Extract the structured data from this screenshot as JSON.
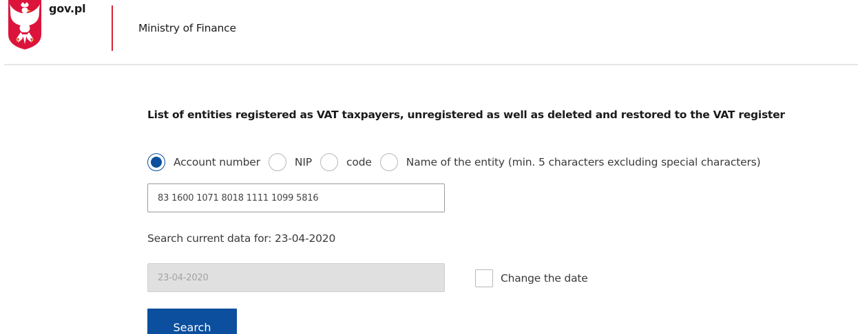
{
  "header": {
    "site_name": "gov.pl",
    "ministry": "Ministry of Finance",
    "colors": {
      "divider": "#d5232f",
      "emblem_bg": "#dc143c"
    }
  },
  "main": {
    "title": "List of entities registered as VAT taxpayers, unregistered as well as deleted and restored to the VAT register",
    "search_type": {
      "options": [
        {
          "label": "Account number",
          "checked": true
        },
        {
          "label": "NIP",
          "checked": false
        },
        {
          "label": "code",
          "checked": false
        },
        {
          "label": "Name of the entity (min. 5 characters excluding special characters)",
          "checked": false
        }
      ]
    },
    "account_input": {
      "value": "83 1600 1071 8018 1111 1099 5816"
    },
    "current_data_text": "Search current data for: 23-04-2020",
    "date_input": {
      "value": "23-04-2020",
      "disabled": true
    },
    "change_date": {
      "label": "Change the date",
      "checked": false
    },
    "search_button": {
      "label": "Search"
    },
    "colors": {
      "primary": "#0b4f9e",
      "disabled_bg": "#e0e0e0"
    }
  }
}
